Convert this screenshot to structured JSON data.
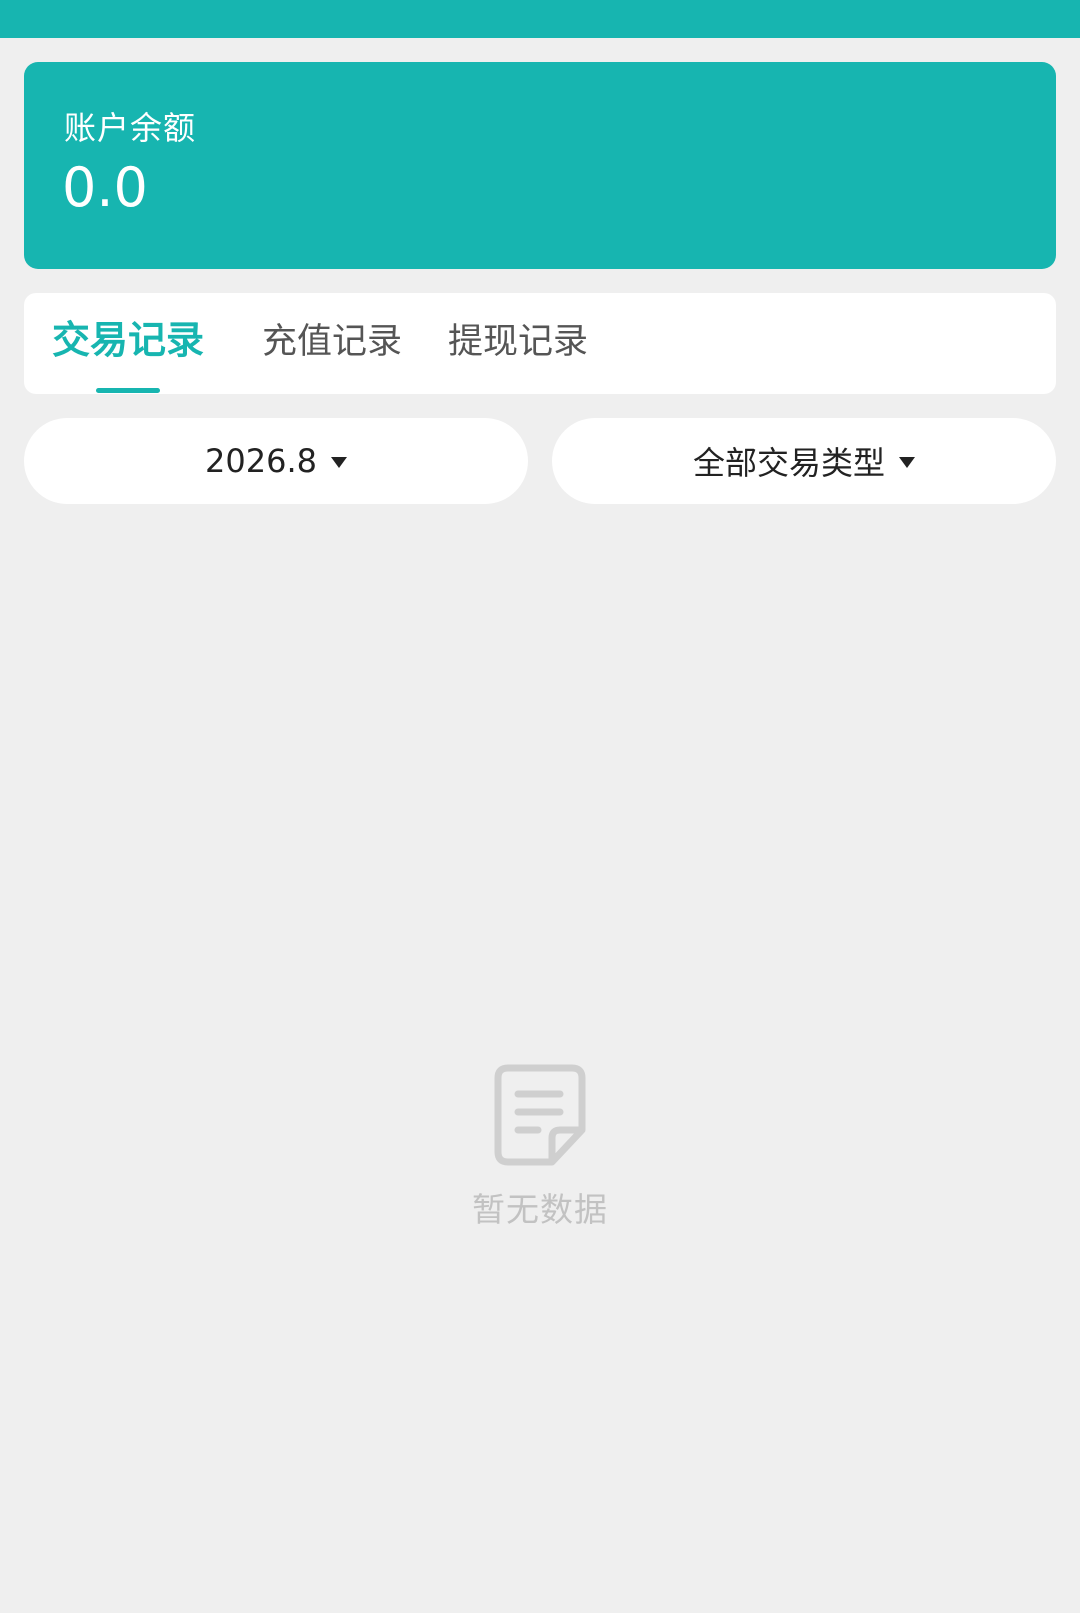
{
  "balance": {
    "label": "账户余额",
    "value": "0.0"
  },
  "tabs": [
    {
      "label": "交易记录",
      "active": true
    },
    {
      "label": "充值记录",
      "active": false
    },
    {
      "label": "提现记录",
      "active": false
    }
  ],
  "filters": {
    "date": "2026.8",
    "type": "全部交易类型"
  },
  "empty_state": {
    "text": "暂无数据",
    "icon": "document-icon"
  },
  "colors": {
    "accent": "#17b5b0",
    "background": "#efefef",
    "empty_text": "#c2c2c2"
  }
}
